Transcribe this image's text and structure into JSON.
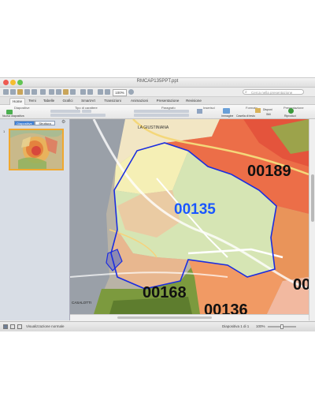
{
  "window": {
    "title": "RMCAP135PPT.ppt"
  },
  "toolbar": {
    "zoom": "100%",
    "search_placeholder": "Cerca nella presentazione"
  },
  "ribbon_tabs": [
    "Home",
    "Temi",
    "Tabelle",
    "Grafici",
    "SmartArt",
    "Transizioni",
    "Animazioni",
    "Presentazione",
    "Revisione"
  ],
  "ribbon": {
    "groups": [
      "Diapositive",
      "Tipo di carattere",
      "Paragrafo",
      "Inserisci",
      "Formato",
      "Presentazione"
    ],
    "buttons": {
      "new_slide": "Nuova diapositiva",
      "image": "Immagine",
      "text_box": "Casella di testo",
      "arrange": "Disponi",
      "styles": "Stili",
      "play": "Riproduci"
    }
  },
  "sidebar": {
    "tab_slides": "Diapositive",
    "tab_outline": "Struttura",
    "slide_number": "1"
  },
  "map": {
    "zones": [
      "00135",
      "00189",
      "00168",
      "00136",
      "00"
    ],
    "place_labels": [
      "LA GIUSTINIANA",
      "CASALOTTI"
    ]
  },
  "status": {
    "view": "Visualizzazione normale",
    "slide": "Diapositiva 1 di 1",
    "zoom": "100%"
  },
  "colors": {
    "accent": "#3d7fd6",
    "zone_highlight": "#1a57ff",
    "zone_border": "#1b2de0"
  }
}
